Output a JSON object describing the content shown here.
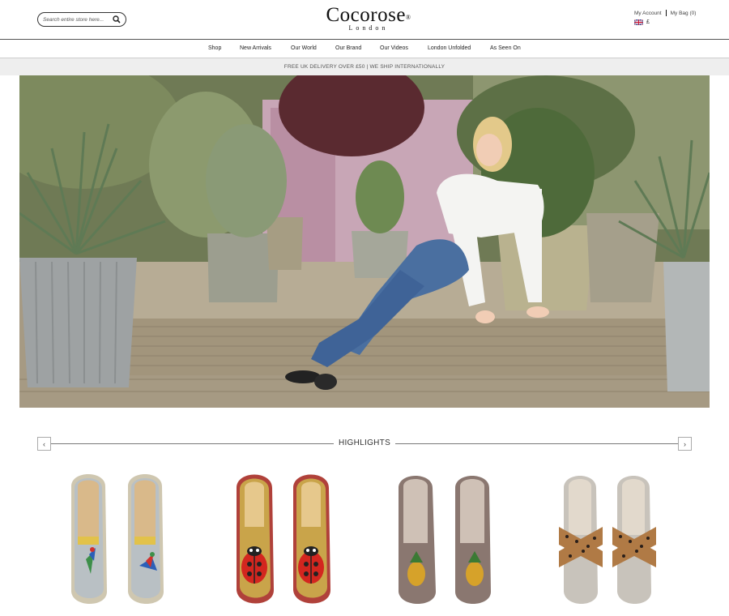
{
  "header": {
    "search_placeholder": "Search entire store here...",
    "logo_brand": "Cocorose",
    "logo_registered": "®",
    "logo_sub": "London",
    "my_account": "My Account",
    "my_bag": "My Bag (0)",
    "currency_symbol": "£"
  },
  "nav": {
    "items": [
      "Shop",
      "New Arrivals",
      "Our World",
      "Our Brand",
      "Our Videos",
      "London Unfolded",
      "As Seen On"
    ]
  },
  "banner": {
    "text": "FREE UK DELIVERY OVER £50 | WE SHIP INTERNATIONALLY"
  },
  "highlights": {
    "title": "HIGHLIGHTS",
    "prev_label": "‹",
    "next_label": "›",
    "products": [
      {
        "icon": "parrot-espadrille",
        "colors": {
          "upper": "#b9c0c4",
          "trim": "#cfc7b0",
          "accent": "#3d8f4a"
        }
      },
      {
        "icon": "ladybird-espadrille",
        "colors": {
          "upper": "#c9a44a",
          "trim": "#b0413a",
          "accent": "#d3261f"
        }
      },
      {
        "icon": "pineapple-ballet-flat",
        "colors": {
          "upper": "#8a7770",
          "trim": "#cfc1b6",
          "accent": "#d6a22a"
        }
      },
      {
        "icon": "leopard-cross-strap-flat",
        "colors": {
          "upper": "#b07a45",
          "trim": "#c8c3bb",
          "accent": "#2a1f1a"
        }
      }
    ]
  },
  "colors": {
    "nav_border": "#555555",
    "strip_bg": "#eeeeee",
    "text": "#222222"
  }
}
